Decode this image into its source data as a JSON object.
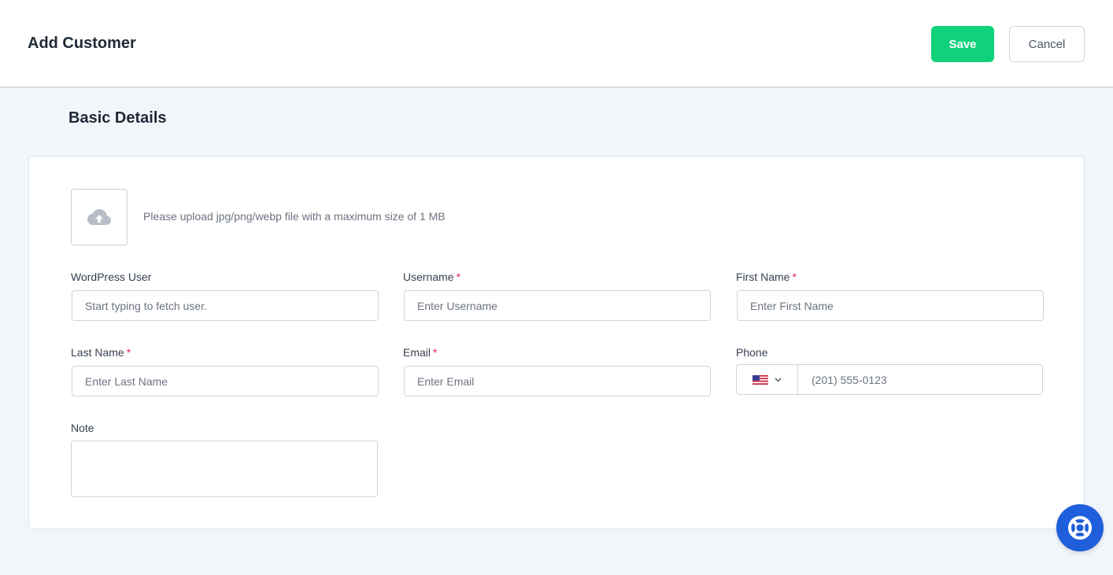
{
  "header": {
    "title": "Add Customer",
    "save_label": "Save",
    "cancel_label": "Cancel"
  },
  "section": {
    "title": "Basic Details"
  },
  "upload": {
    "icon": "cloud-upload-icon",
    "hint": "Please upload jpg/png/webp file with a maximum size of 1 MB"
  },
  "fields": {
    "wp_user": {
      "label": "WordPress User",
      "required": false,
      "placeholder": "Start typing to fetch user.",
      "value": ""
    },
    "username": {
      "label": "Username",
      "required": true,
      "placeholder": "Enter Username",
      "value": ""
    },
    "first_name": {
      "label": "First Name",
      "required": true,
      "placeholder": "Enter First Name",
      "value": ""
    },
    "last_name": {
      "label": "Last Name",
      "required": true,
      "placeholder": "Enter Last Name",
      "value": ""
    },
    "email": {
      "label": "Email",
      "required": true,
      "placeholder": "Enter Email",
      "value": ""
    },
    "phone": {
      "label": "Phone",
      "country_icon": "us-flag-icon",
      "placeholder": "(201) 555-0123",
      "value": ""
    },
    "note": {
      "label": "Note",
      "value": ""
    }
  },
  "required_marker": "*",
  "help": {
    "icon": "lifebuoy-icon"
  },
  "colors": {
    "primary": "#10d27a",
    "help_fab": "#1f5fdc",
    "required": "#e11d48",
    "background": "#f2f6fb"
  }
}
